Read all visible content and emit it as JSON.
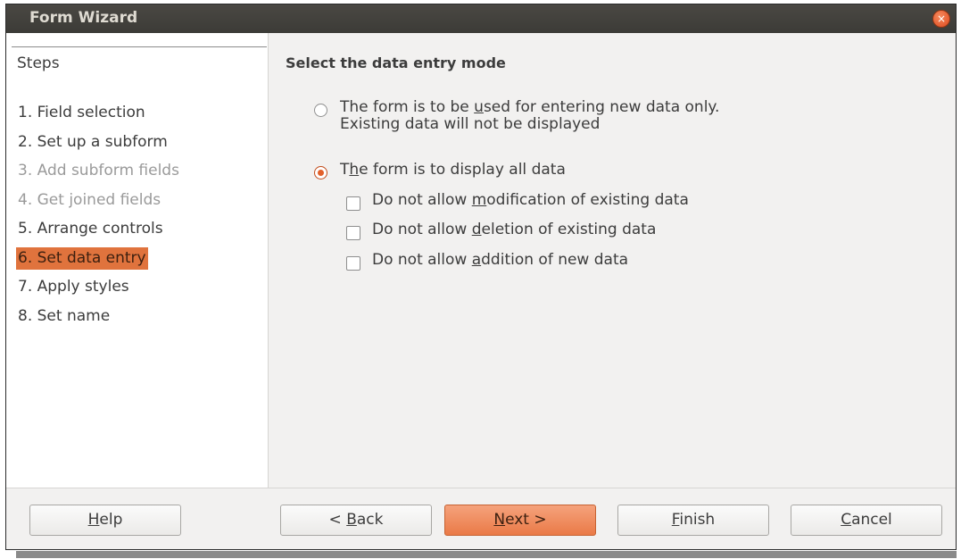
{
  "window": {
    "title": "Form Wizard",
    "close_glyph": "×"
  },
  "steps": {
    "header": "Steps",
    "items": [
      {
        "label": "1. Field selection",
        "state": "enabled"
      },
      {
        "label": "2. Set up a subform",
        "state": "enabled"
      },
      {
        "label": "3. Add subform fields",
        "state": "disabled"
      },
      {
        "label": "4. Get joined fields",
        "state": "disabled"
      },
      {
        "label": "5. Arrange controls",
        "state": "enabled"
      },
      {
        "label": "6. Set data entry",
        "state": "active"
      },
      {
        "label": "7. Apply styles",
        "state": "enabled"
      },
      {
        "label": "8. Set name",
        "state": "enabled"
      }
    ]
  },
  "main": {
    "title": "Select the data entry mode",
    "radio_new_only": {
      "line1_pre": "The form is to be ",
      "line1_u": "u",
      "line1_post": "sed for entering new data only.",
      "line2": "Existing data will not be displayed",
      "checked": false
    },
    "radio_all": {
      "pre": "T",
      "u": "h",
      "post": "e form is to display all data",
      "checked": true
    },
    "check_no_modify": {
      "pre": "Do not allow ",
      "u": "m",
      "post": "odification of existing data",
      "checked": false
    },
    "check_no_delete": {
      "pre": "Do not allow ",
      "u": "d",
      "post": "eletion of existing data",
      "checked": false
    },
    "check_no_add": {
      "pre": "Do not allow ",
      "u": "a",
      "post": "ddition of new data",
      "checked": false
    }
  },
  "footer": {
    "help": {
      "u": "H",
      "post": "elp"
    },
    "back": {
      "pre": "< ",
      "u": "B",
      "post": "ack"
    },
    "next": {
      "u": "N",
      "post": "ext >"
    },
    "finish": {
      "u": "F",
      "post": "inish"
    },
    "cancel": {
      "u": "C",
      "post": "ancel"
    }
  },
  "colors": {
    "accent": "#e0733d",
    "titlebar": "#3c3b37",
    "dialog_bg": "#f2f1f0"
  }
}
